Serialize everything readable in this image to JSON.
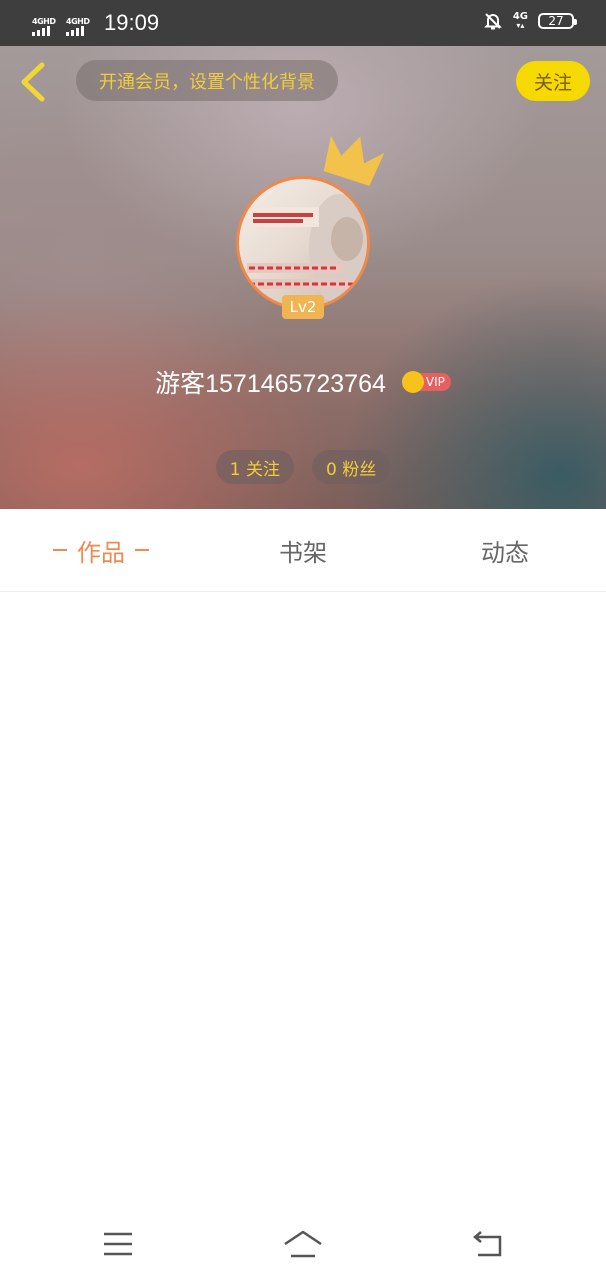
{
  "status_bar": {
    "sim1_label": "4GHD",
    "sim2_label": "4GHD",
    "time": "19:09",
    "network_label": "4G",
    "battery": "27",
    "icons": [
      "signal-icon",
      "mute-bell-icon",
      "battery-icon"
    ]
  },
  "header": {
    "vip_banner": "开通会员，设置个性化背景",
    "follow_label": "关注",
    "level": "Lv2",
    "username": "游客1571465723764",
    "vip_label": "VIP",
    "following_count": "1 关注",
    "followers_count": "0 粉丝",
    "accent_color": "#f6d900",
    "banner_text_color": "#f1cd3a"
  },
  "tabs": {
    "items": [
      {
        "label": "作品",
        "active": true
      },
      {
        "label": "书架",
        "active": false
      },
      {
        "label": "动态",
        "active": false
      }
    ],
    "active_color": "#ef8a52"
  },
  "nav_bar": {
    "icons": [
      "menu-icon",
      "home-icon",
      "back-icon"
    ]
  }
}
